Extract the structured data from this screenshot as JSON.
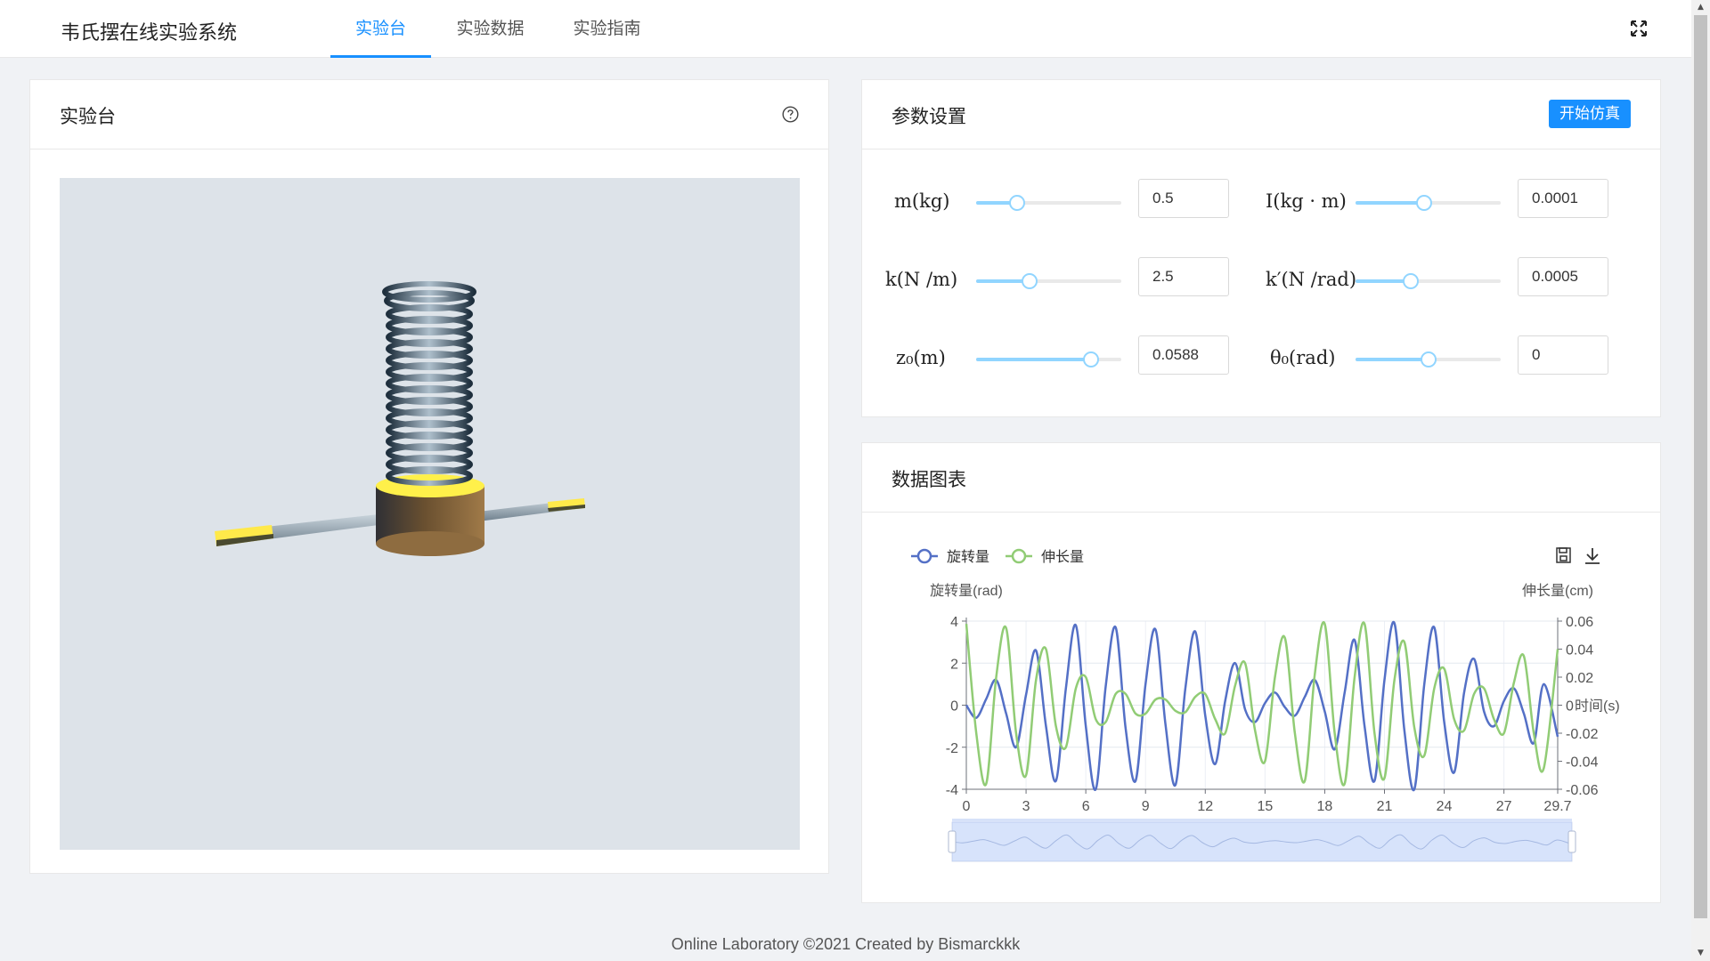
{
  "header": {
    "app_title": "韦氏摆在线实验系统",
    "tabs": [
      {
        "label": "实验台",
        "active": true
      },
      {
        "label": "实验数据",
        "active": false
      },
      {
        "label": "实验指南",
        "active": false
      }
    ],
    "fullscreen_icon": "fullscreen-icon"
  },
  "colors": {
    "primary": "#1890ff",
    "slider": "#91d5ff",
    "rotation_series": "#5470c6",
    "elongation_series": "#91cc75",
    "scene_bg": "#dde3e9"
  },
  "bench": {
    "title": "实验台",
    "help_icon": "question-circle-icon"
  },
  "params": {
    "title": "参数设置",
    "start_button": "开始仿真",
    "items": [
      {
        "label": "m(kg)",
        "value": "0.5",
        "slider_fraction": 0.28
      },
      {
        "label": "I(kg · m)",
        "value": "0.0001",
        "slider_fraction": 0.47
      },
      {
        "label": "k(N /m)",
        "value": "2.5",
        "slider_fraction": 0.37
      },
      {
        "label": "k′(N /rad)",
        "value": "0.0005",
        "slider_fraction": 0.38
      },
      {
        "label": "z₀(m)",
        "value": "0.0588",
        "slider_fraction": 0.79
      },
      {
        "label": "θ₀(rad)",
        "value": "0",
        "slider_fraction": 0.5
      }
    ]
  },
  "chart_card": {
    "title": "数据图表",
    "toolbox_icons": [
      "save-icon",
      "download-icon"
    ]
  },
  "chart_data": {
    "type": "line",
    "legend": [
      "旋转量",
      "伸长量"
    ],
    "left_axis_label": "旋转量(rad)",
    "right_axis_label": "伸长量(cm)",
    "x_axis_label": "时间(s)",
    "x_ticks": [
      "0",
      "3",
      "6",
      "9",
      "12",
      "15",
      "18",
      "21",
      "24",
      "27",
      "29.7"
    ],
    "xlim": [
      0,
      29.7
    ],
    "left_ticks": [
      "4",
      "2",
      "0",
      "-2",
      "-4"
    ],
    "left_ylim": [
      -4,
      4
    ],
    "right_ticks": [
      "0.06",
      "0.04",
      "0.02",
      "0",
      "-0.02",
      "-0.04",
      "-0.06"
    ],
    "right_ylim": [
      -0.06,
      0.06
    ],
    "series": [
      {
        "name": "旋转量",
        "axis": "left",
        "x": [
          0,
          0.5,
          1,
          1.5,
          2,
          2.5,
          3,
          3.5,
          4,
          4.5,
          5,
          5.5,
          6,
          6.5,
          7,
          7.5,
          8,
          8.5,
          9,
          9.5,
          10,
          10.5,
          11,
          11.5,
          12,
          12.5,
          13,
          13.5,
          14,
          14.5,
          15,
          15.5,
          16,
          16.5,
          17,
          17.5,
          18,
          18.5,
          19,
          19.5,
          20,
          20.5,
          21,
          21.5,
          22,
          22.5,
          23,
          23.5,
          24,
          24.5,
          25,
          25.5,
          26,
          26.5,
          27,
          27.5,
          28,
          28.5,
          29,
          29.7
        ],
        "y": [
          0,
          -0.6,
          0.3,
          1.2,
          -0.4,
          -2.0,
          0.5,
          2.6,
          -1.0,
          -3.6,
          0.8,
          3.8,
          -1.0,
          -4.0,
          0.9,
          3.7,
          -1.1,
          -3.6,
          1.0,
          3.6,
          -0.9,
          -3.8,
          0.8,
          3.5,
          -0.5,
          -2.8,
          0.2,
          2.0,
          -0.2,
          -0.8,
          0.1,
          0.6,
          -0.1,
          -0.5,
          0.4,
          1.2,
          -0.3,
          -2.1,
          0.6,
          3.1,
          -1.0,
          -3.6,
          1.2,
          3.9,
          -1.2,
          -4.0,
          1.0,
          3.7,
          -0.8,
          -3.2,
          0.6,
          2.2,
          -0.3,
          -1.0,
          0.2,
          0.8,
          -0.4,
          -1.8,
          1.0,
          -1.5
        ]
      },
      {
        "name": "伸长量",
        "axis": "right",
        "x": [
          0,
          0.5,
          1,
          1.5,
          2,
          2.5,
          3,
          3.5,
          4,
          4.5,
          5,
          5.5,
          6,
          6.5,
          7,
          7.5,
          8,
          8.5,
          9,
          9.5,
          10,
          10.5,
          11,
          11.5,
          12,
          12.5,
          13,
          13.5,
          14,
          14.5,
          15,
          15.5,
          16,
          16.5,
          17,
          17.5,
          18,
          18.5,
          19,
          19.5,
          20,
          20.5,
          21,
          21.5,
          22,
          22.5,
          23,
          23.5,
          24,
          24.5,
          25,
          25.5,
          26,
          26.5,
          27,
          27.5,
          28,
          28.5,
          29,
          29.7
        ],
        "y": [
          0.058,
          -0.02,
          -0.056,
          0.02,
          0.055,
          -0.02,
          -0.05,
          0.018,
          0.04,
          -0.015,
          -0.03,
          0.012,
          0.02,
          -0.01,
          -0.012,
          0.008,
          0.008,
          -0.006,
          -0.006,
          0.004,
          0.004,
          -0.004,
          -0.005,
          0.006,
          0.008,
          -0.01,
          -0.02,
          0.014,
          0.03,
          -0.018,
          -0.04,
          0.02,
          0.048,
          -0.02,
          -0.054,
          0.022,
          0.058,
          -0.02,
          -0.056,
          0.02,
          0.058,
          -0.02,
          -0.052,
          0.018,
          0.045,
          -0.016,
          -0.036,
          0.012,
          0.026,
          -0.01,
          -0.018,
          0.008,
          0.012,
          -0.01,
          -0.02,
          0.016,
          0.035,
          -0.02,
          -0.045,
          0.04
        ]
      }
    ],
    "datazoom": {
      "start_percent": 0,
      "end_percent": 100
    }
  },
  "footer": {
    "text": "Online Laboratory ©2021 Created by Bismarckkk"
  }
}
